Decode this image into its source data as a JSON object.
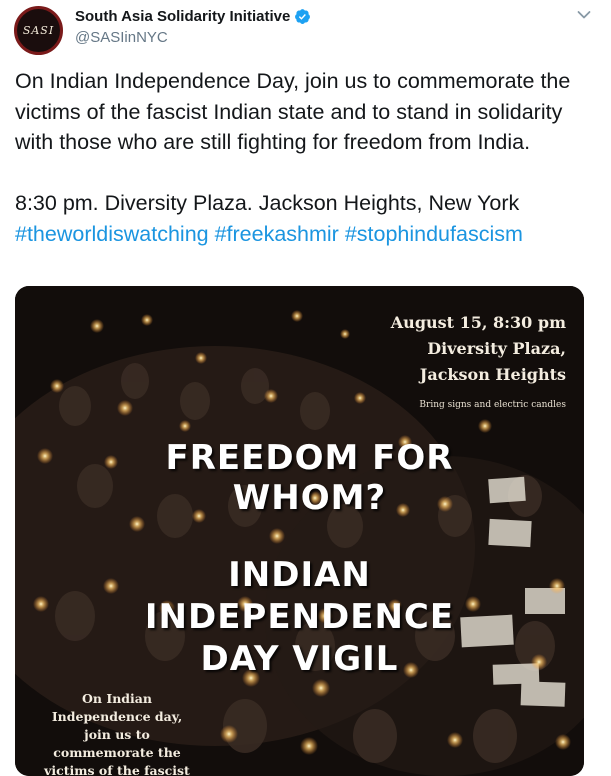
{
  "account": {
    "avatar_text": "SASI",
    "display_name": "South Asia Solidarity Initiative",
    "handle": "@SASIinNYC",
    "verified": true
  },
  "tweet": {
    "paragraph1": "On Indian Independence Day, join us to commemorate the victims of the fascist Indian state and to stand in solidarity with those who are still fighting for freedom from India.",
    "details": "8:30 pm. Diversity Plaza. Jackson Heights, New York",
    "hashtags": "#theworldiswatching #freekashmir #stophindufascism"
  },
  "poster": {
    "date_time": "August 15, 8:30 pm",
    "venue": "Diversity Plaza,",
    "area": "Jackson Heights",
    "note": "Bring signs and electric candles",
    "headline1_line1": "FREEDOM FOR",
    "headline1_line2": "WHOM?",
    "headline2_line1": "INDIAN",
    "headline2_line2": "INDEPENDENCE",
    "headline2_line3": "DAY VIGIL",
    "caption": "On Indian Independence day, join us to commemorate the victims of the fascist"
  },
  "colors": {
    "hashtag": "#1b95e0",
    "verified": "#1da1f2",
    "text": "#14171a",
    "secondary": "#657786"
  },
  "icons": {
    "verified": "verified-badge-icon",
    "menu": "chevron-down-icon"
  }
}
